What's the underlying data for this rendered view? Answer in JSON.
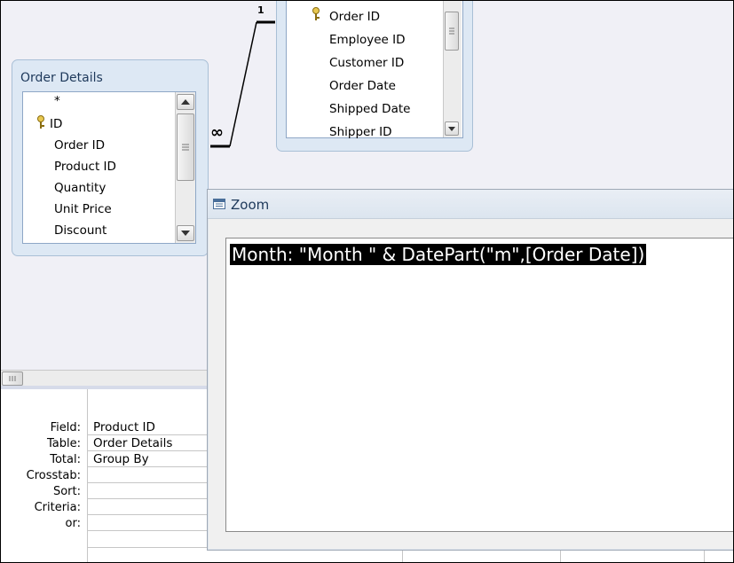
{
  "orders_table": {
    "fields": [
      "Order ID",
      "Employee ID",
      "Customer ID",
      "Order Date",
      "Shipped Date",
      "Shipper ID"
    ],
    "key_field": "Order ID"
  },
  "order_details_table": {
    "title": "Order Details",
    "fields": [
      "*",
      "ID",
      "Order ID",
      "Product ID",
      "Quantity",
      "Unit Price",
      "Discount"
    ],
    "key_field": "ID"
  },
  "relationship": {
    "one_label": "1",
    "many_label": "∞"
  },
  "grid": {
    "row_labels": [
      "Field:",
      "Table:",
      "Total:",
      "Crosstab:",
      "Sort:",
      "Criteria:",
      "or:"
    ],
    "column1": [
      "Product ID",
      "Order Details",
      "Group By",
      "",
      "",
      "",
      ""
    ]
  },
  "zoom_dialog": {
    "title": "Zoom",
    "expression": "Month: \"Month \" & DatePart(\"m\",[Order Date])"
  },
  "icons": {
    "key": "key-icon",
    "zoom_window": "zoom-window-icon",
    "scroll_up": "scroll-up-arrow-icon",
    "scroll_down": "scroll-down-arrow-icon",
    "scroll_grip": "scroll-grip-icon"
  },
  "colors": {
    "highlight_bg": "#000000",
    "highlight_text": "#ffffff",
    "titlebar_text": "#1e395b"
  }
}
